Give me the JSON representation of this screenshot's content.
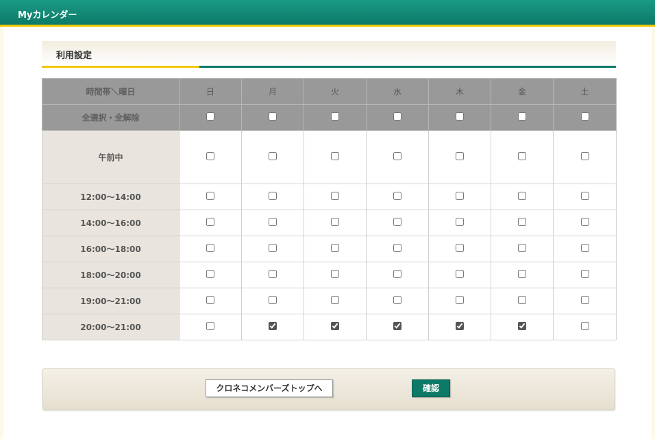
{
  "header": {
    "title": "Myカレンダー"
  },
  "section": {
    "title": "利用設定"
  },
  "table": {
    "corner_label": "時間帯＼曜日",
    "days": [
      "日",
      "月",
      "火",
      "水",
      "木",
      "金",
      "土"
    ],
    "select_all_label": "全選択・全解除",
    "rows": [
      {
        "label": "午前中",
        "checked": [
          false,
          false,
          false,
          false,
          false,
          false,
          false
        ]
      },
      {
        "label": "12:00～14:00",
        "checked": [
          false,
          false,
          false,
          false,
          false,
          false,
          false
        ]
      },
      {
        "label": "14:00～16:00",
        "checked": [
          false,
          false,
          false,
          false,
          false,
          false,
          false
        ]
      },
      {
        "label": "16:00～18:00",
        "checked": [
          false,
          false,
          false,
          false,
          false,
          false,
          false
        ]
      },
      {
        "label": "18:00～20:00",
        "checked": [
          false,
          false,
          false,
          false,
          false,
          false,
          false
        ]
      },
      {
        "label": "19:00～21:00",
        "checked": [
          false,
          false,
          false,
          false,
          false,
          false,
          false
        ]
      },
      {
        "label": "20:00～21:00",
        "checked": [
          false,
          true,
          true,
          true,
          true,
          true,
          false
        ]
      }
    ]
  },
  "footer": {
    "back_button": "クロネコメンバーズトップへ",
    "confirm_button": "確認"
  }
}
